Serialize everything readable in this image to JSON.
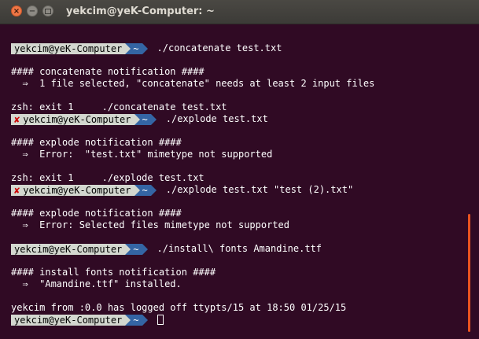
{
  "window": {
    "title": "yekcim@yeK-Computer: ~",
    "controls": {
      "close_icon": "×",
      "minimize_icon": "−"
    }
  },
  "prompt": {
    "user_host": "yekcim@yeK-Computer",
    "dir": "~",
    "error_mark": "✘"
  },
  "lines": [
    {
      "type": "prompt",
      "error": false,
      "cmd": "./concatenate test.txt"
    },
    {
      "type": "blank"
    },
    {
      "type": "text",
      "text": "#### concatenate notification ####"
    },
    {
      "type": "text",
      "text": "  ⇒  1 file selected, \"concatenate\" needs at least 2 input files"
    },
    {
      "type": "blank"
    },
    {
      "type": "text",
      "text": "zsh: exit 1     ./concatenate test.txt"
    },
    {
      "type": "prompt",
      "error": true,
      "cmd": "./explode test.txt"
    },
    {
      "type": "blank"
    },
    {
      "type": "text",
      "text": "#### explode notification ####"
    },
    {
      "type": "text",
      "text": "  ⇒  Error:  \"test.txt\" mimetype not supported"
    },
    {
      "type": "blank"
    },
    {
      "type": "text",
      "text": "zsh: exit 1     ./explode test.txt"
    },
    {
      "type": "prompt",
      "error": true,
      "cmd": "./explode test.txt \"test (2).txt\""
    },
    {
      "type": "blank"
    },
    {
      "type": "text",
      "text": "#### explode notification ####"
    },
    {
      "type": "text",
      "text": "  ⇒  Error: Selected files mimetype not supported"
    },
    {
      "type": "blank"
    },
    {
      "type": "prompt",
      "error": false,
      "cmd": "./install\\ fonts Amandine.ttf"
    },
    {
      "type": "blank"
    },
    {
      "type": "text",
      "text": "#### install fonts notification ####"
    },
    {
      "type": "text",
      "text": "  ⇒  \"Amandine.ttf\" installed."
    },
    {
      "type": "blank"
    },
    {
      "type": "text",
      "text": "yekcim from :0.0 has logged off ttypts/15 at 18:50 01/25/15"
    },
    {
      "type": "prompt",
      "error": false,
      "cmd": "",
      "cursor": true
    }
  ],
  "colors": {
    "terminal_bg": "#300a24",
    "prompt_user_bg": "#d3d7cf",
    "prompt_dir_bg": "#3465a4",
    "error_mark": "#cc0000",
    "scrollbar_thumb": "#e95420"
  }
}
